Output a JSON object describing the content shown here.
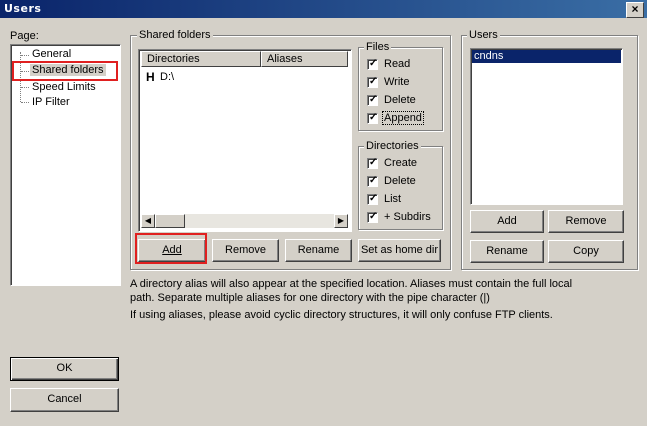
{
  "window": {
    "title": "Users",
    "close_label": "×"
  },
  "page_panel": {
    "label": "Page:",
    "items": [
      {
        "label": "General"
      },
      {
        "label": "Shared folders",
        "selected": true
      },
      {
        "label": "Speed Limits"
      },
      {
        "label": "IP Filter"
      }
    ]
  },
  "shared_folders": {
    "group_label": "Shared folders",
    "columns": [
      "Directories",
      "Aliases"
    ],
    "rows": [
      {
        "marker": "H",
        "directory": "D:\\",
        "alias": ""
      }
    ],
    "buttons": {
      "add": "Add",
      "remove": "Remove",
      "rename": "Rename",
      "set_home": "Set as home dir"
    }
  },
  "files_group": {
    "label": "Files",
    "options": [
      {
        "label": "Read",
        "checked": true
      },
      {
        "label": "Write",
        "checked": true
      },
      {
        "label": "Delete",
        "checked": true
      },
      {
        "label": "Append",
        "checked": true
      }
    ]
  },
  "dirs_group": {
    "label": "Directories",
    "options": [
      {
        "label": "Create",
        "checked": true
      },
      {
        "label": "Delete",
        "checked": true
      },
      {
        "label": "List",
        "checked": true
      },
      {
        "label": "+ Subdirs",
        "checked": true
      }
    ]
  },
  "users_panel": {
    "label": "Users",
    "items": [
      {
        "label": "cndns",
        "selected": true
      }
    ],
    "buttons": {
      "add": "Add",
      "remove": "Remove",
      "rename": "Rename",
      "copy": "Copy"
    }
  },
  "info": {
    "line1": "A directory alias will also appear at the specified location. Aliases must contain the full local",
    "line2": "path. Separate multiple aliases for one directory with the pipe character (|)",
    "line3": "If using aliases, please avoid cyclic directory structures, it will only confuse FTP clients."
  },
  "footer": {
    "ok": "OK",
    "cancel": "Cancel"
  },
  "colors": {
    "title_bar": "#0a246a",
    "selection": "#0a246a",
    "highlight_box": "#e02020",
    "face": "#d4d0c8"
  }
}
